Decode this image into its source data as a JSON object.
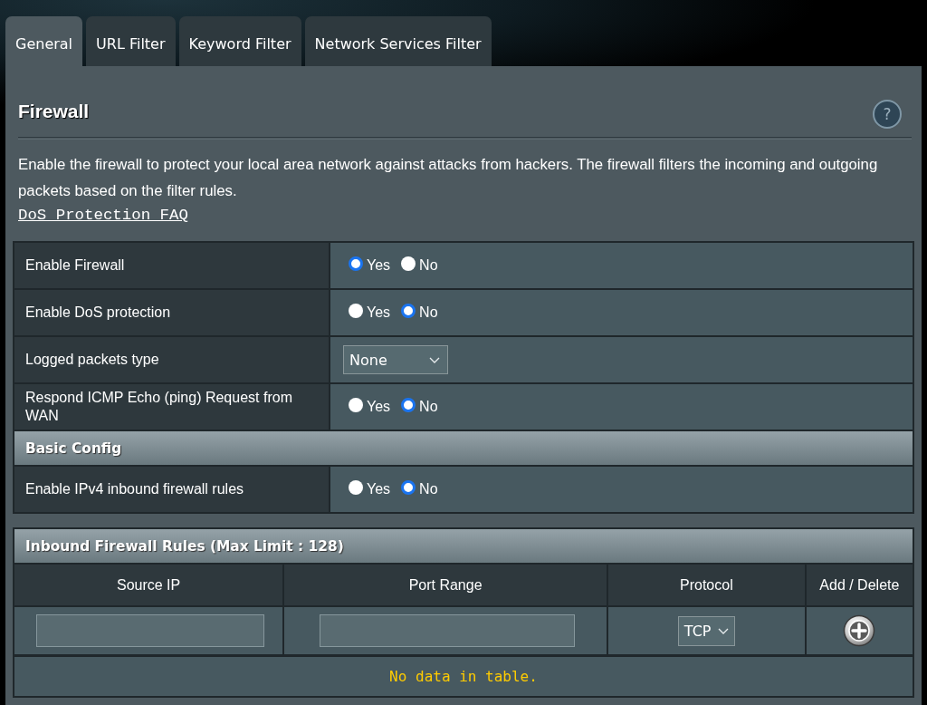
{
  "tabs": [
    {
      "label": "General",
      "selected": true
    },
    {
      "label": "URL Filter",
      "selected": false
    },
    {
      "label": "Keyword Filter",
      "selected": false
    },
    {
      "label": "Network Services Filter",
      "selected": false
    }
  ],
  "section": {
    "title": "Firewall",
    "help": "?",
    "description": "Enable the firewall to protect your local area network against attacks from hackers. The firewall filters the incoming and outgoing packets based on the filter rules.",
    "link": "DoS Protection FAQ"
  },
  "settings": [
    {
      "kind": "radio",
      "label": "Enable Firewall",
      "options": [
        {
          "label": "Yes",
          "selected": true
        },
        {
          "label": "No",
          "selected": false
        }
      ]
    },
    {
      "kind": "radio",
      "label": "Enable DoS protection",
      "options": [
        {
          "label": "Yes",
          "selected": false
        },
        {
          "label": "No",
          "selected": true
        }
      ]
    },
    {
      "kind": "select",
      "label": "Logged packets type",
      "value": "None"
    },
    {
      "kind": "radio",
      "label": "Respond ICMP Echo (ping) Request from WAN",
      "options": [
        {
          "label": "Yes",
          "selected": false
        },
        {
          "label": "No",
          "selected": true
        }
      ]
    },
    {
      "kind": "header",
      "label": "Basic Config"
    },
    {
      "kind": "radio",
      "label": "Enable IPv4 inbound firewall rules",
      "options": [
        {
          "label": "Yes",
          "selected": false
        },
        {
          "label": "No",
          "selected": true
        }
      ]
    }
  ],
  "rules_table": {
    "title": "Inbound Firewall Rules (Max Limit : 128)",
    "columns": [
      "Source IP",
      "Port Range",
      "Protocol",
      "Add / Delete"
    ],
    "new_rule": {
      "protocol": "TCP"
    },
    "empty_message": "No data in table."
  }
}
